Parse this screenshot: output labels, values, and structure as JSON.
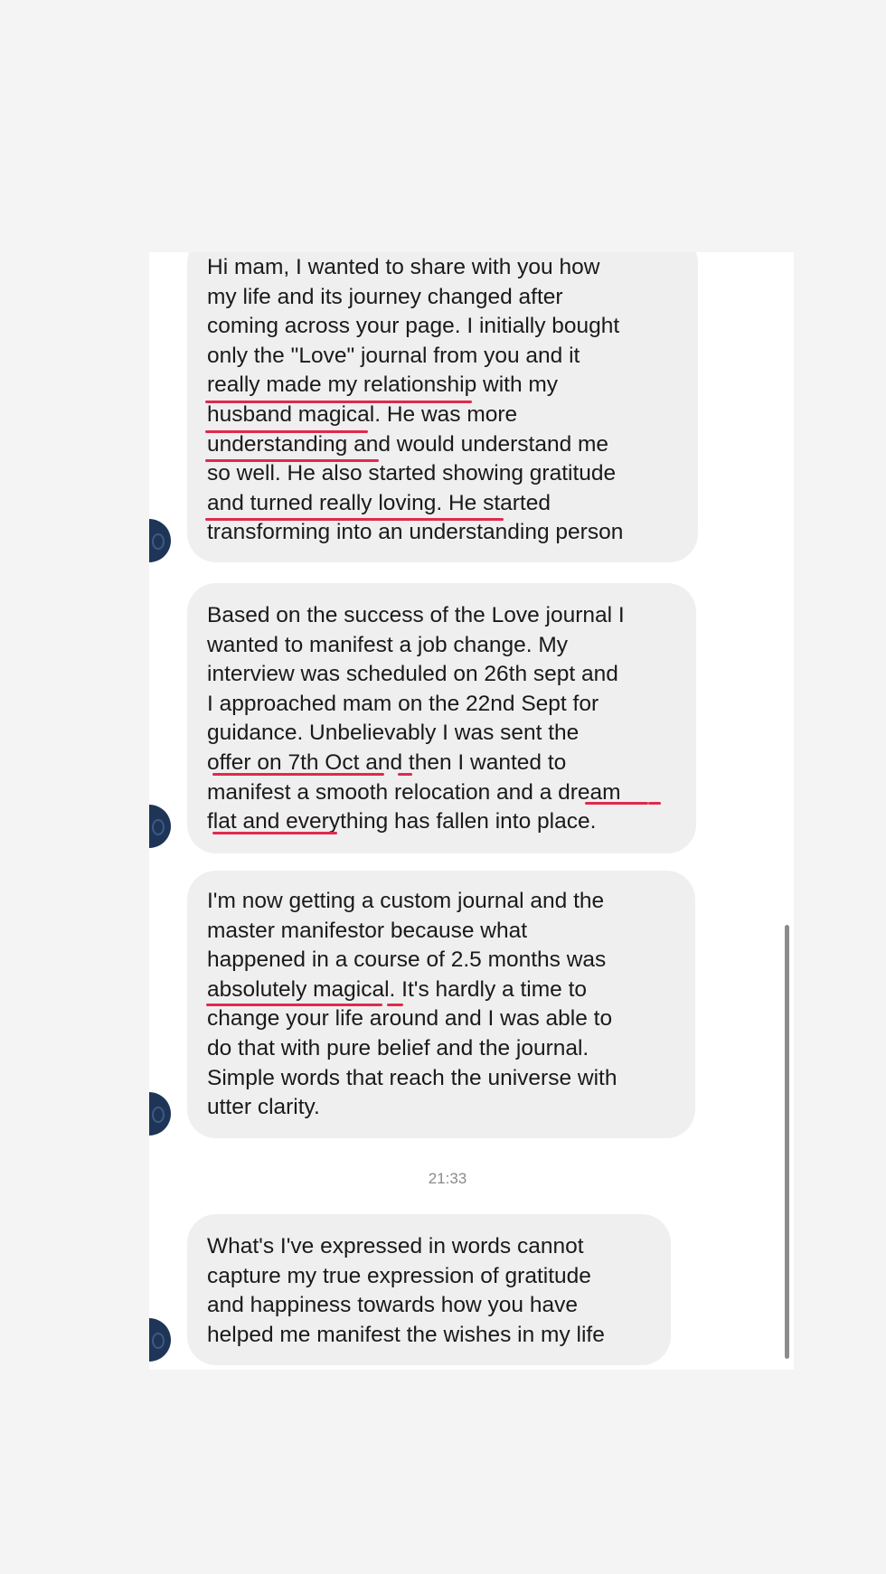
{
  "conversation": {
    "messages": [
      {
        "lines": [
          "Hi mam, I wanted to share with you how",
          "my life and its journey changed after",
          "coming across your page. I initially bought",
          "only the \"Love\" journal from you and it",
          "really made my relationship with my",
          "husband magical. He was more",
          "understanding and would understand me",
          "so well. He also started showing gratitude",
          "and turned really loving. He started",
          "transforming into an understanding person"
        ]
      },
      {
        "lines": [
          "Based on the success of the Love journal I",
          "wanted to manifest a job change. My",
          "interview was scheduled on 26th sept and",
          "I approached mam on the 22nd Sept for",
          "guidance. Unbelievably I was sent the",
          "offer on 7th Oct and then I wanted to",
          "manifest a smooth relocation and a dream",
          "flat and everything has fallen into place."
        ]
      },
      {
        "lines": [
          "I'm now getting a custom journal and the",
          "master manifestor because what",
          "happened in a course of 2.5 months was",
          "absolutely magical. It's hardly a time to",
          "change your life around and I was able to",
          "do that with pure belief and the journal.",
          "Simple words that reach the universe with",
          "utter clarity."
        ]
      },
      {
        "lines": [
          "What's I've expressed in words cannot",
          "capture my true expression of gratitude",
          "and happiness towards how you have",
          "helped me manifest the wishes in my life"
        ]
      }
    ],
    "timestamp": "21:33"
  },
  "colors": {
    "bubble": "#efefef",
    "underline": "#e0294b",
    "avatar": "#1e3558"
  },
  "icons": [
    "avatar-icon"
  ]
}
